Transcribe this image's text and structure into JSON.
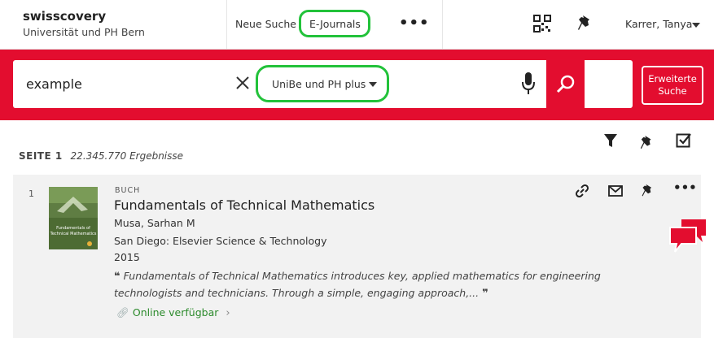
{
  "brand": {
    "name": "swisscovery",
    "subtitle": "Universität und PH Bern"
  },
  "nav": {
    "new_search": "Neue Suche",
    "ejournals": "E-Journals",
    "more": "•••"
  },
  "user": {
    "name": "Karrer, Tanya"
  },
  "search": {
    "query": "example",
    "scope": "UniBe und PH plus",
    "advanced_line1": "Erweiterte",
    "advanced_line2": "Suche"
  },
  "results": {
    "page_label": "SEITE 1",
    "count_text": "22.345.770 Ergebnisse"
  },
  "result_item": {
    "number": "1",
    "type": "BUCH",
    "title": "Fundamentals of Technical Mathematics",
    "author": "Musa, Sarhan M",
    "publisher": "San Diego: Elsevier Science & Technology",
    "year": "2015",
    "abstract": "Fundamentals of Technical Mathematics introduces key, applied mathematics for engineering technologists and technicians. Through a simple, engaging approach,...",
    "availability": "Online verfügbar",
    "cover_title_line1": "Fundamentals of",
    "cover_title_line2": "Technical Mathematics"
  },
  "colors": {
    "primary_red": "#e30d2f",
    "highlight_green": "#22c23a",
    "available_green": "#2b8a2b"
  },
  "icons": [
    "qr-code-icon",
    "pin-icon",
    "clear-icon",
    "microphone-icon",
    "search-icon",
    "filter-icon",
    "checkbox-icon",
    "link-icon",
    "email-icon",
    "more-icon",
    "chat-icon"
  ]
}
